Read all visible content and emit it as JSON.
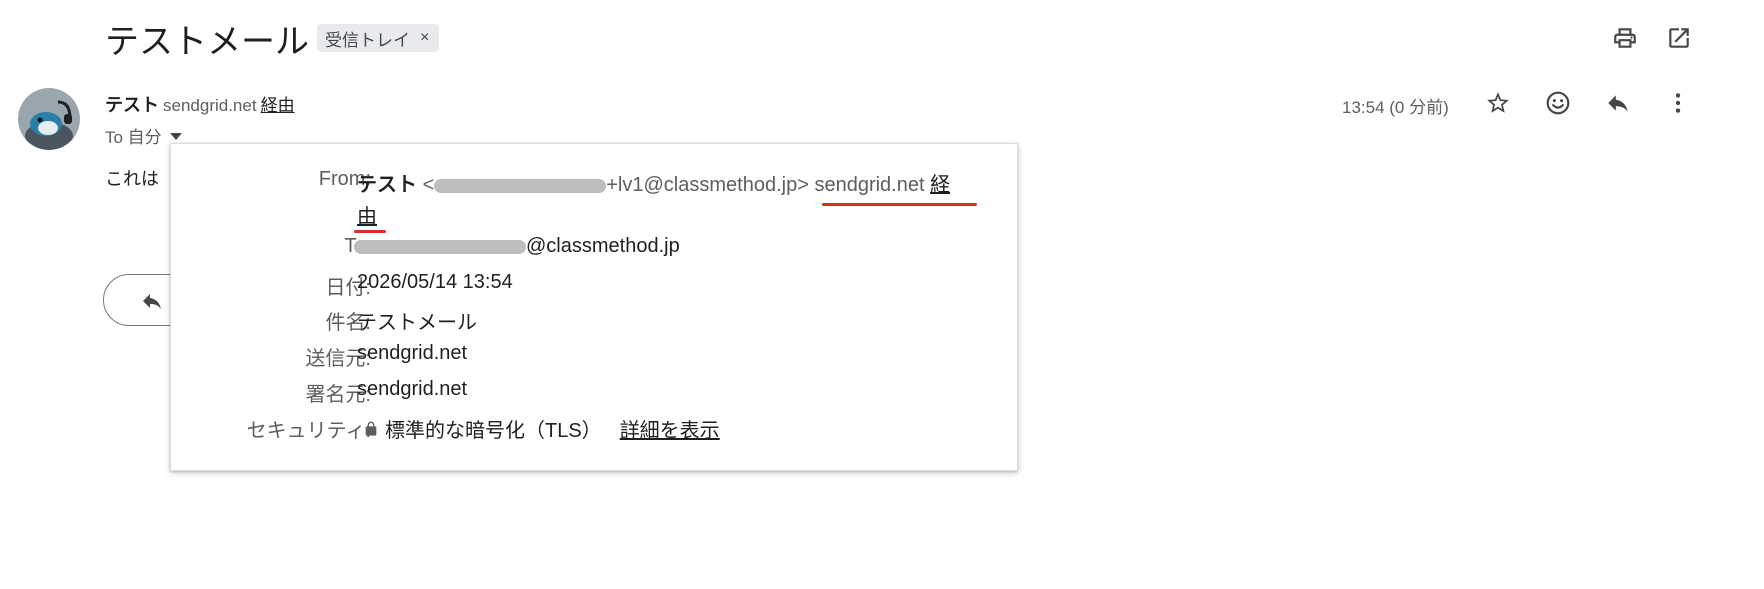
{
  "header": {
    "subject": "テストメール",
    "label": "受信トレイ",
    "label_close": "×",
    "icons": [
      "print-icon",
      "open-in-new-window-icon"
    ]
  },
  "message": {
    "sender_name": "テスト",
    "via_domain": "sendgrid.net",
    "via_link": "経由",
    "to_line": "To 自分",
    "time": "13:54 (0 分前)",
    "body_preview": "これは",
    "actions": [
      "star-icon",
      "emoji-reaction-icon",
      "reply-icon",
      "more-options-icon"
    ]
  },
  "details_popup": {
    "from_label": "From:",
    "from_name": "テスト",
    "from_addr_open": "<",
    "from_addr_tail": "+lv1@classmethod.jp>",
    "from_via_domain": "sendgrid.net",
    "from_via_1": "経",
    "from_via_2": "由",
    "to_label": "To:",
    "to_addr_tail": "@classmethod.jp",
    "date_label": "日付:",
    "date_value": "2026/05/14 13:54",
    "subject_label": "件名:",
    "subject_value": "テストメール",
    "mailed_by_label": "送信元:",
    "mailed_by_value": "sendgrid.net",
    "signed_by_label": "署名元:",
    "signed_by_value": "sendgrid.net",
    "security_label": "セキュリティ:",
    "security_value": "標準的な暗号化（TLS）",
    "security_link": "詳細を表示"
  },
  "colors": {
    "annotation": "#d93025",
    "chip_bg": "#e8eaed",
    "text_secondary": "#5e5e5e"
  }
}
